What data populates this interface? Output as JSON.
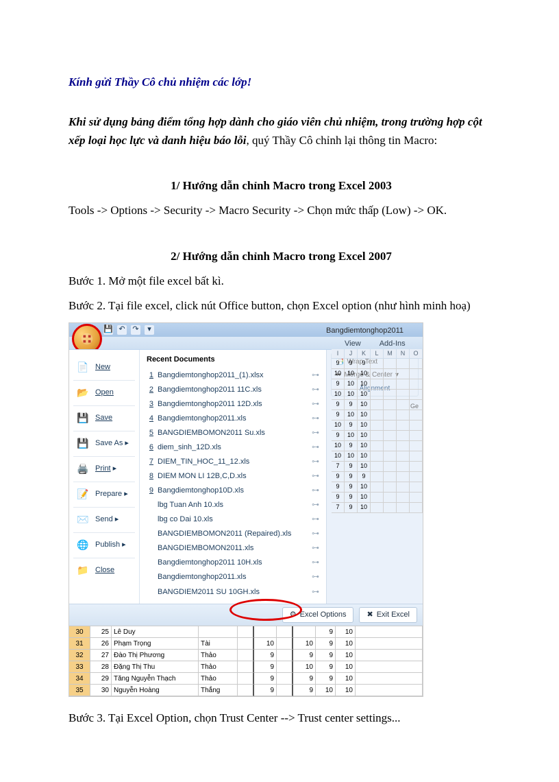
{
  "greeting": "Kính gửi Thầy Cô chủ nhiệm các lớp!",
  "intro_bold": "Khi sử dụng bảng điểm tổng hợp dành cho giáo viên chủ nhiệm, trong trường hợp cột xếp loại học lực và danh hiệu báo lỗi",
  "intro_tail": ", quý Thầy Cô chỉnh lại thông tin Macro:",
  "section1_heading": "1/ Hướng dẫn chỉnh Macro trong Excel 2003",
  "section1_text": "Tools -> Options -> Security -> Macro Security -> Chọn mức thấp (Low) -> OK.",
  "section2_heading": "2/ Hướng dẫn chỉnh Macro trong Excel 2007",
  "step1": "Bước 1. Mở một file excel bất kì.",
  "step2": "Bước 2. Tại file excel, click nút Office button, chọn Excel option (như hình minh hoạ)",
  "step3": "Bước 3. Tại Excel Option, chọn Trust Center --> Trust center settings...",
  "excel": {
    "window_title": "Bangdiemtonghop2011",
    "tabs": {
      "view": "View",
      "addins": "Add-Ins"
    },
    "ribbon": {
      "wrap": "Wrap Text",
      "merge": "Merge & Center",
      "gen": "Ge",
      "group": "Alignment"
    },
    "menu": {
      "new": "New",
      "open": "Open",
      "save": "Save",
      "saveas": "Save As",
      "print": "Print",
      "prepare": "Prepare",
      "send": "Send",
      "publish": "Publish",
      "close": "Close"
    },
    "recent_hdr": "Recent Documents",
    "recent": [
      "Bangdiemtonghop2011_(1).xlsx",
      "Bangdiemtonghop2011 11C.xls",
      "Bangdiemtonghop2011 12D.xls",
      "Bangdiemtonghop2011.xls",
      "BANGDIEMBOMON2011 Su.xls",
      "diem_sinh_12D.xls",
      "DIEM_TIN_HOC_11_12.xls",
      "DIEM MON LI 12B,C,D.xls",
      "Bangdiemtonghop10D.xls",
      "lbg Tuan Anh 10.xls",
      "lbg co Dai 10.xls",
      "BANGDIEMBOMON2011 (Repaired).xls",
      "BANGDIEMBOMON2011.xls",
      "Bangdiemtonghop2011 10H.xls",
      "Bangdiemtonghop2011.xls",
      "BANGDIEM2011 SU 10GH.xls"
    ],
    "footer": {
      "options": "Excel Options",
      "exit": "Exit Excel"
    },
    "cols": [
      "I",
      "J",
      "K",
      "L",
      "M",
      "N",
      "O"
    ],
    "mini_rows": [
      [
        "9",
        "9",
        "9"
      ],
      [
        "10",
        "10",
        "10"
      ],
      [
        "9",
        "10",
        "10"
      ],
      [
        "10",
        "10",
        "10"
      ],
      [
        "9",
        "9",
        "10"
      ],
      [
        "9",
        "10",
        "10"
      ],
      [
        "10",
        "9",
        "10"
      ],
      [
        "9",
        "10",
        "10"
      ],
      [
        "10",
        "9",
        "10"
      ],
      [
        "10",
        "10",
        "10"
      ],
      [
        "7",
        "9",
        "10"
      ],
      [
        "9",
        "9",
        "9"
      ],
      [
        "9",
        "9",
        "10"
      ],
      [
        "9",
        "9",
        "10"
      ],
      [
        "7",
        "9",
        "10"
      ]
    ],
    "sheet_rows": [
      {
        "r": "30",
        "a": "25",
        "b": "Lê Duy",
        "c": "",
        "e": "",
        "g": "",
        "h": "9",
        "i": "10"
      },
      {
        "r": "31",
        "a": "26",
        "b": "Phạm Trọng",
        "c": "Tài",
        "e": "10",
        "g": "10",
        "h": "9",
        "i": "10"
      },
      {
        "r": "32",
        "a": "27",
        "b": "Đào Thị Phương",
        "c": "Thảo",
        "e": "9",
        "g": "9",
        "h": "9",
        "i": "10"
      },
      {
        "r": "33",
        "a": "28",
        "b": "Đặng Thị Thu",
        "c": "Thảo",
        "e": "9",
        "g": "10",
        "h": "9",
        "i": "10"
      },
      {
        "r": "34",
        "a": "29",
        "b": "Tăng Nguyễn Thạch",
        "c": "Thảo",
        "e": "9",
        "g": "9",
        "h": "9",
        "i": "10"
      },
      {
        "r": "35",
        "a": "30",
        "b": "Nguyễn Hoàng",
        "c": "Thắng",
        "e": "9",
        "g": "9",
        "h": "10",
        "i": "10"
      }
    ]
  }
}
